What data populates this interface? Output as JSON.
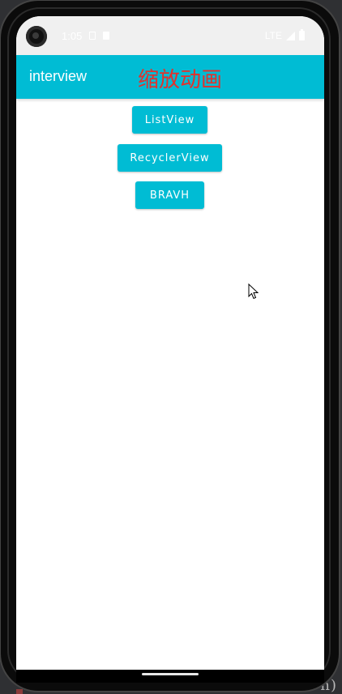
{
  "backdrop": {
    "code_fragment": "n)"
  },
  "status_bar": {
    "time": "1:05",
    "network": "LTE",
    "icons": [
      "sim-card-icon",
      "sd-card-icon",
      "signal-icon",
      "battery-icon"
    ]
  },
  "app_bar": {
    "title": "interview",
    "subtitle": "缩放动画",
    "subtitle_color": "#e5302a",
    "background": "#00bcd4"
  },
  "buttons": {
    "listview_label": "ListView",
    "recyclerview_label": "RecyclerView",
    "bravh_label": "BRAVH"
  },
  "colors": {
    "accent": "#00bcd4",
    "screen_background": "#ffffff"
  }
}
